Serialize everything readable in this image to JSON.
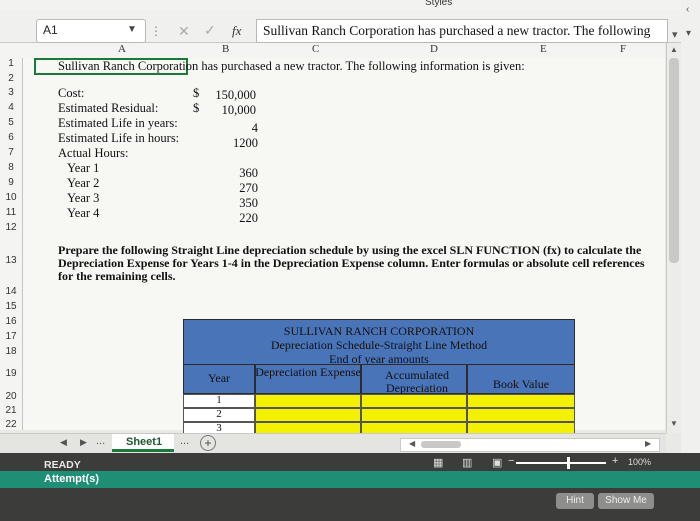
{
  "top_strip": {
    "styles_label": "Styles"
  },
  "formula_bar": {
    "name_box": "A1",
    "dots": "⋮",
    "cancel_glyph": "✕",
    "enter_glyph": "✓",
    "fx_glyph": "fx",
    "formula": "Sullivan Ranch Corporation has purchased a new tractor.  The following"
  },
  "columns": [
    "A",
    "B",
    "C",
    "D",
    "E",
    "F"
  ],
  "rows": [
    "1",
    "2",
    "3",
    "4",
    "5",
    "6",
    "7",
    "8",
    "9",
    "10",
    "11",
    "12",
    "13",
    "14",
    "15",
    "16",
    "17",
    "18",
    "19",
    "20",
    "21",
    "22"
  ],
  "cells": {
    "a1": "Sullivan Ranch Corporation has purchased a new tractor.  The following information is given:",
    "a3": "Cost:",
    "a4": "Estimated Residual:",
    "a5": "Estimated Life in years:",
    "a6": "Estimated Life in hours:",
    "a7": "Actual Hours:",
    "a8": "Year 1",
    "a9": "Year 2",
    "a10": "Year 3",
    "a11": "Year 4",
    "dollar3": "$",
    "dollar4": "$",
    "b3": "150,000",
    "b4": "10,000",
    "b5": "4",
    "b6": "1200",
    "b8": "360",
    "b9": "270",
    "b10": "350",
    "b11": "220"
  },
  "instructions": "Prepare the following Straight Line depreciation schedule by using the excel SLN FUNCTION (fx) to calculate the Depreciation Expense for Years 1-4 in the Depreciation Expense column.  Enter formulas or absolute cell references for the remaining cells.",
  "schedule": {
    "title1": "SULLIVAN RANCH CORPORATION",
    "title2": "Depreciation Schedule-Straight Line Method",
    "title3": "End of year amounts",
    "col_year": "Year",
    "col_dep_expense": "Depreciation Expense",
    "col_accum": "Accumulated Depreciation",
    "col_book": "Book Value",
    "years": [
      "1",
      "2",
      "3"
    ]
  },
  "tabs": {
    "sheet1": "Sheet1",
    "more": "...",
    "add": "+"
  },
  "status": {
    "ready": "READY",
    "attempt": "Attempt(s)",
    "zoom": "100%",
    "hint": "Hint",
    "show_me": "Show Me"
  },
  "colors": {
    "schedule_blue": "#4a74b8",
    "input_yellow": "#f3f000",
    "selection_green": "#1a7a3a",
    "attempt_bar": "#1e8f74"
  }
}
